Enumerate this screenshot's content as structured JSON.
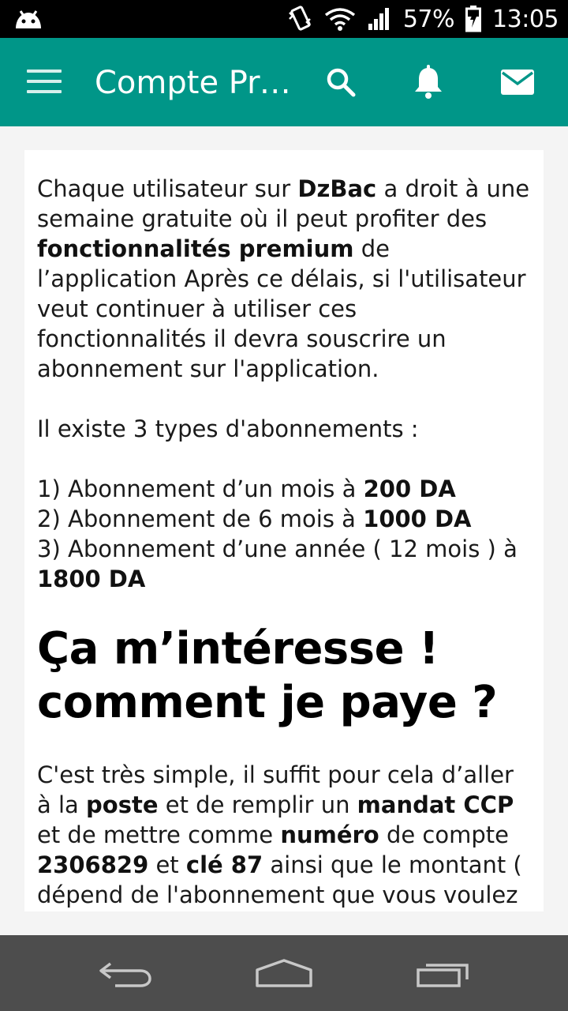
{
  "status_bar": {
    "battery_percent": "57%",
    "time": "13:05",
    "icons": [
      "android-notification-icon",
      "vibrate-icon",
      "wifi-icon",
      "signal-icon",
      "battery-charging-icon"
    ]
  },
  "app_bar": {
    "title": "Compte Pre…",
    "icons": [
      "menu-icon",
      "search-icon",
      "bell-icon",
      "mail-icon"
    ],
    "color": "#009688"
  },
  "content": {
    "intro": {
      "t1": "Chaque utilisateur sur ",
      "b1": "DzBac",
      "t2": " a droit à une semaine gratuite où il peut profiter des ",
      "b2": "fonctionnalités premium",
      "t3": " de l’application Après ce délais, si l'utilisateur veut continuer à utiliser ces fonctionnalités il devra souscrire un abonnement sur l'application."
    },
    "types_intro": "Il existe 3 types d'abonnements :",
    "plans": [
      {
        "text": "1) Abonnement d’un mois à ",
        "price": "200 DA"
      },
      {
        "text": "2) Abonnement de 6 mois à ",
        "price": "1000 DA"
      },
      {
        "text": "3) Abonnement d’une année ( 12 mois ) à ",
        "price": "1800 DA"
      }
    ],
    "heading": "Ça m’intéresse ! comment je paye ?",
    "payment": {
      "t1": "C'est très simple, il suffit pour cela d’aller à la ",
      "b1": "poste",
      "t2": " et de remplir un ",
      "b2": "mandat CCP",
      "t3": " et de mettre comme ",
      "b3": "numéro",
      "t4": " de compte ",
      "b4": "2306829",
      "t5": " et ",
      "b5": "clé 87",
      "t6": " ainsi que le montant ( dépend de l'abonnement que vous voulez )."
    }
  },
  "nav_bar": {
    "icons": [
      "back-icon",
      "home-icon",
      "recents-icon"
    ]
  }
}
